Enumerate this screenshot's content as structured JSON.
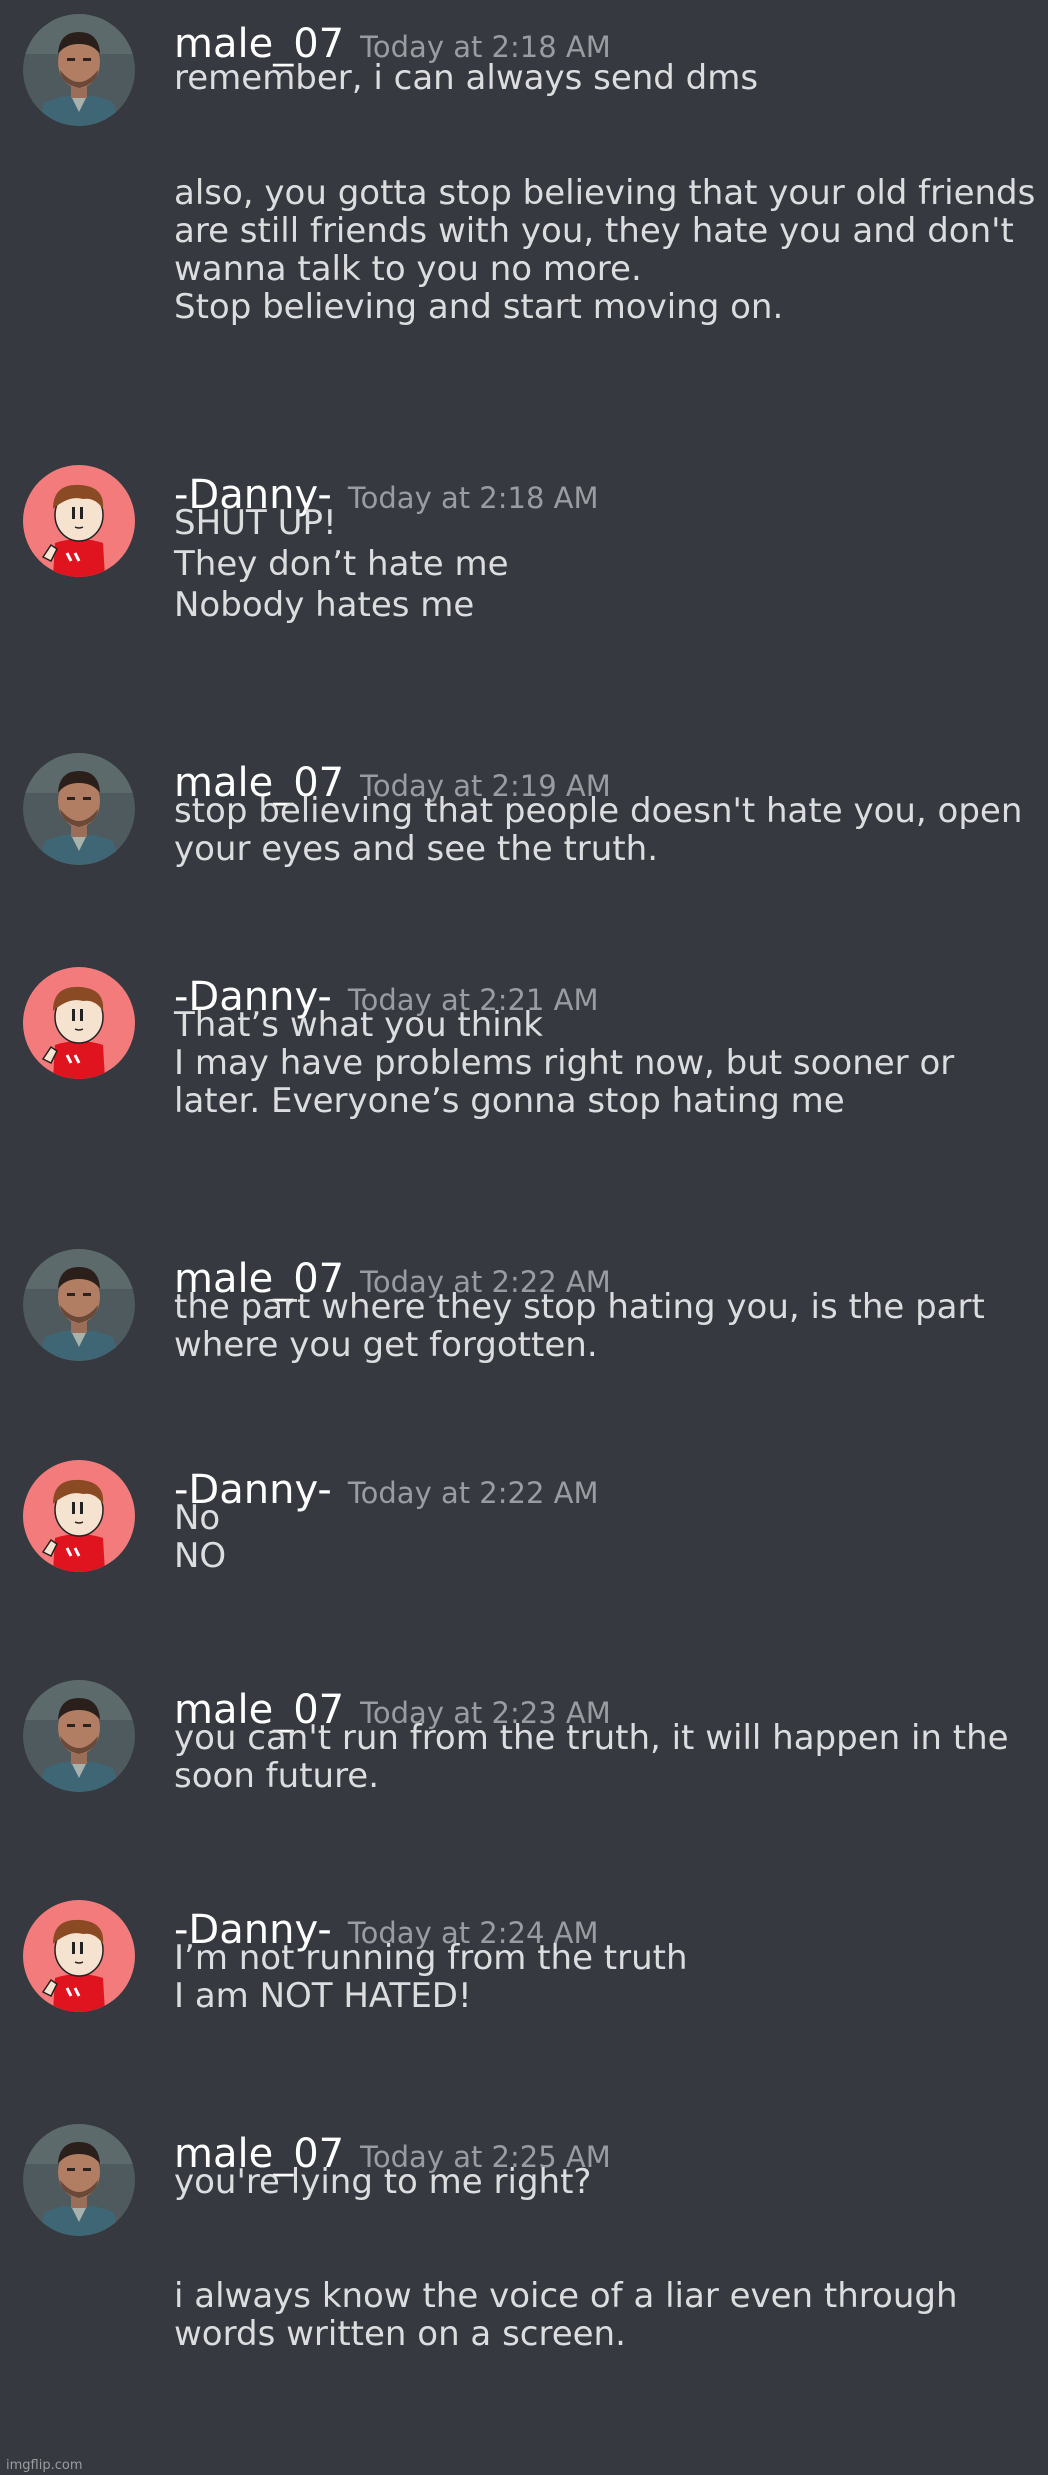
{
  "messages": [
    {
      "author": "male_07",
      "avatar": "male07-face-avatar",
      "time": "Today at 2:18 AM",
      "lines": [
        "remember, i can always send dms",
        "",
        "also, you gotta stop believing that your old friends",
        "are still friends with you, they hate you and don't",
        "wanna talk to you no more.",
        "Stop believing and start moving on."
      ]
    },
    {
      "author": "-Danny-",
      "avatar": "danny-cartoon-avatar",
      "time": "Today at 2:18 AM",
      "lines": [
        "SHUT UP!",
        "They don’t hate me",
        "Nobody hates me"
      ]
    },
    {
      "author": "male_07",
      "avatar": "male07-face-avatar",
      "time": "Today at 2:19 AM",
      "lines": [
        "stop believing that people doesn't hate you, open",
        "your eyes and see the truth."
      ]
    },
    {
      "author": "-Danny-",
      "avatar": "danny-cartoon-avatar",
      "time": "Today at 2:21 AM",
      "lines": [
        "That’s what you think",
        "I may have problems right now, but sooner or",
        "later. Everyone’s gonna stop hating me"
      ]
    },
    {
      "author": "male_07",
      "avatar": "male07-face-avatar",
      "time": "Today at 2:22 AM",
      "lines": [
        "the part where they stop hating you, is the part",
        "where you get forgotten."
      ]
    },
    {
      "author": "-Danny-",
      "avatar": "danny-cartoon-avatar",
      "time": "Today at 2:22 AM",
      "lines": [
        "No",
        "NO"
      ]
    },
    {
      "author": "male_07",
      "avatar": "male07-face-avatar",
      "time": "Today at 2:23 AM",
      "lines": [
        "you can't run from the truth, it will happen in the",
        "soon future."
      ]
    },
    {
      "author": "-Danny-",
      "avatar": "danny-cartoon-avatar",
      "time": "Today at 2:24 AM",
      "lines": [
        "I’m not running from the truth",
        "I am NOT HATED!"
      ]
    },
    {
      "author": "male_07",
      "avatar": "male07-face-avatar",
      "time": "Today at 2:25 AM",
      "lines": [
        "you're lying to me right?",
        "",
        "i always know the voice of a liar even through",
        "words written on a screen."
      ]
    }
  ],
  "watermark": "imgflip.com",
  "colors": {
    "background": "#36393f",
    "username": "#ffffff",
    "timestamp": "#999ca1",
    "message_text": "#dcddde",
    "danny_avatar_bg": "#f47b7b",
    "danny_shirt": "#e0141e"
  }
}
